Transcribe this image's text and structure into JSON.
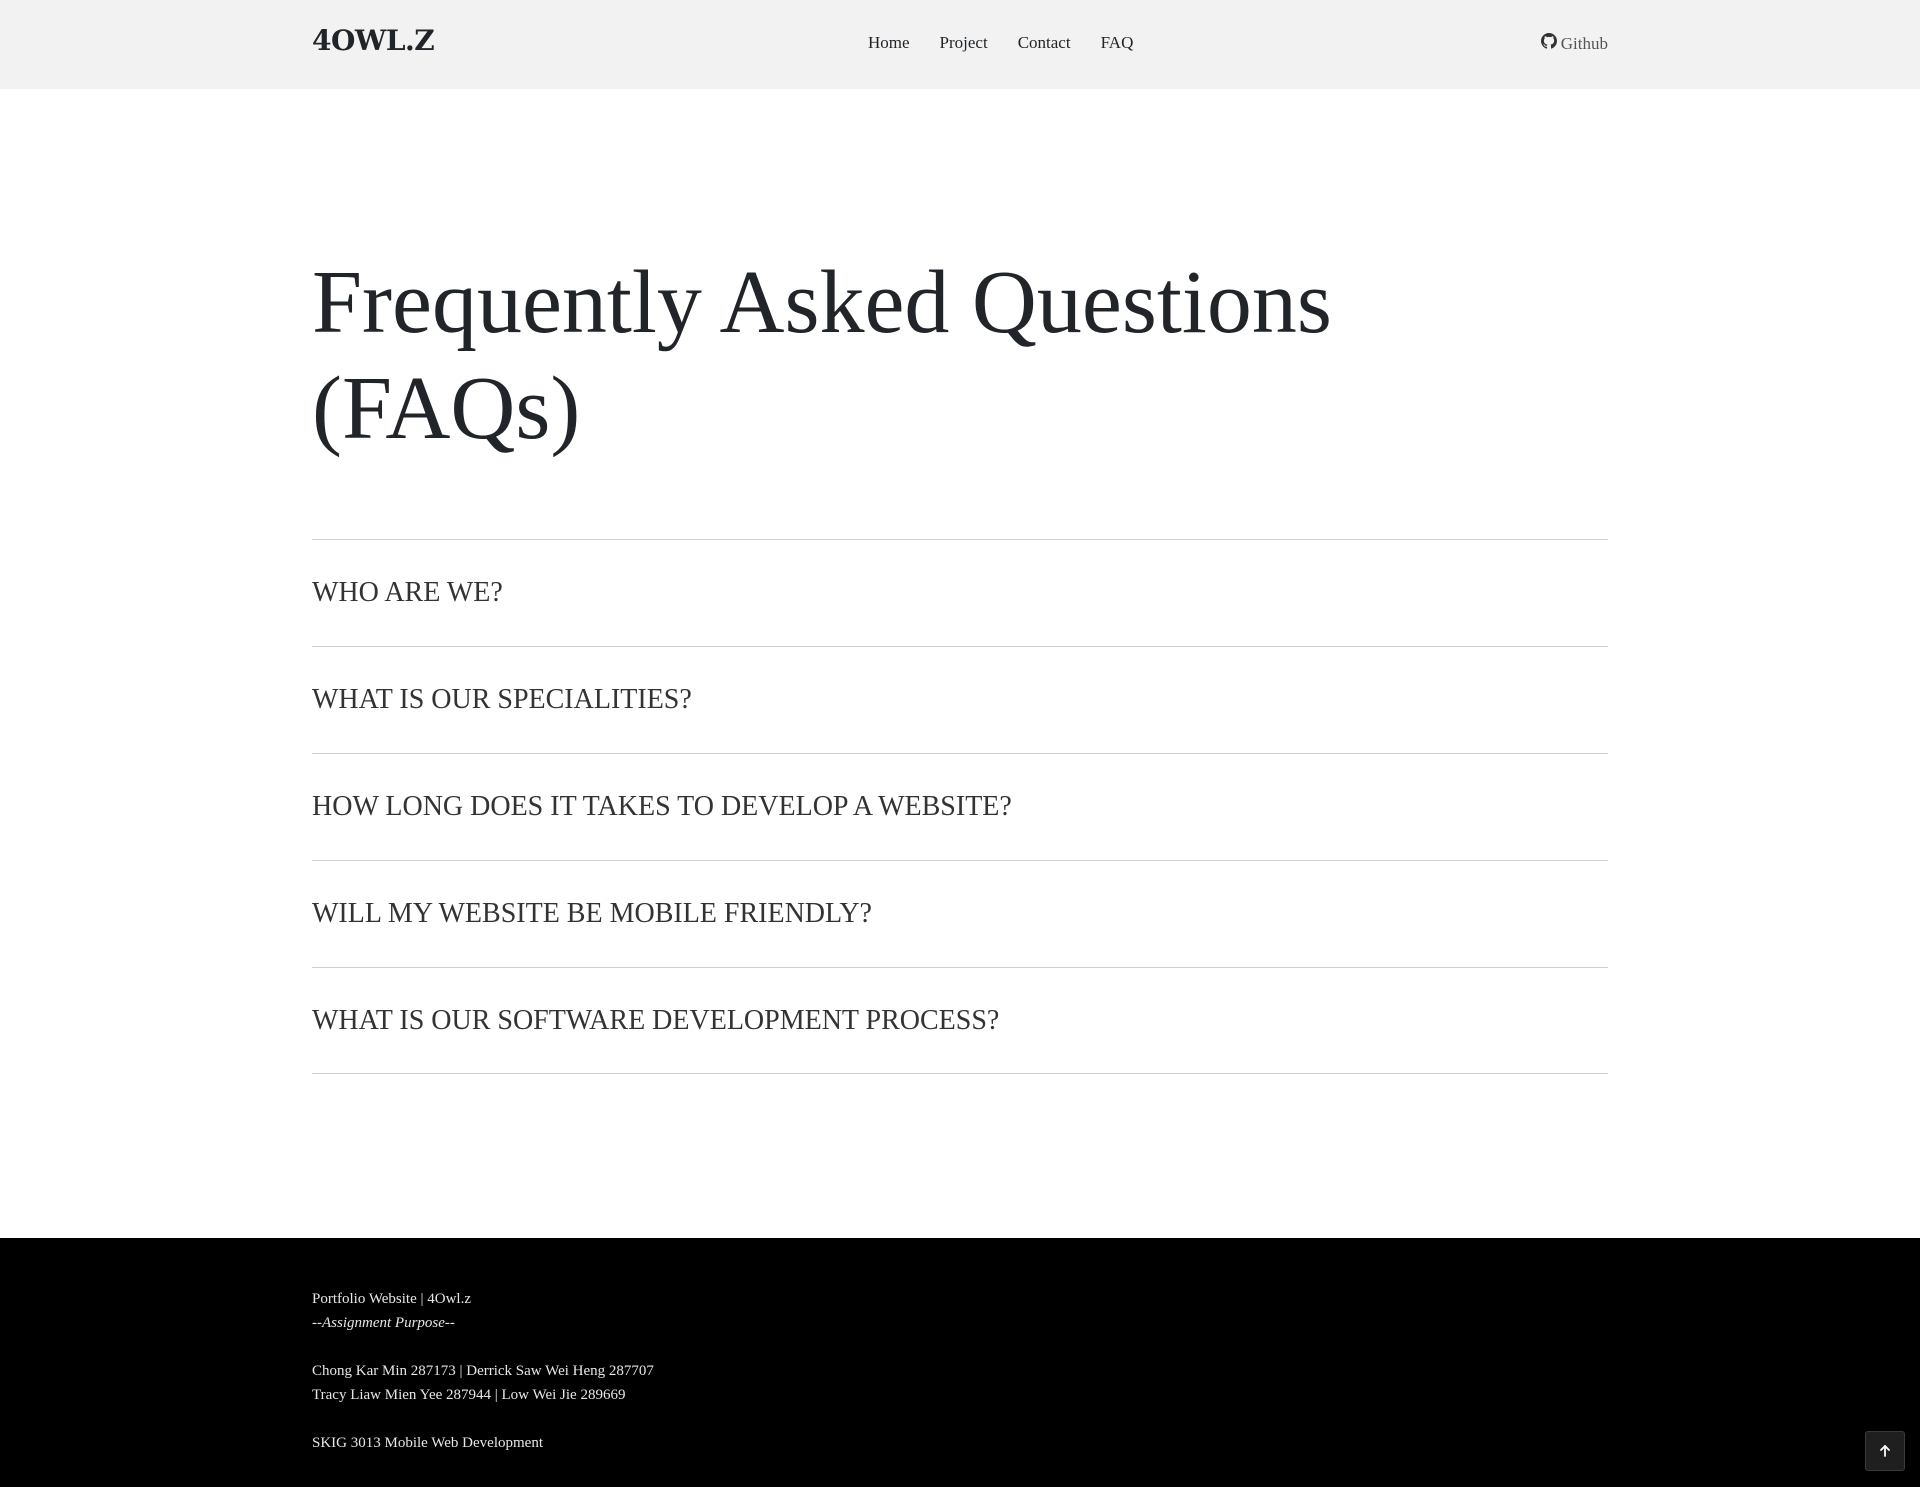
{
  "navbar": {
    "brand": "4OWL.Z",
    "links": [
      "Home",
      "Project",
      "Contact",
      "FAQ"
    ],
    "github_label": "Github"
  },
  "hero": {
    "title_line1": "Frequently Asked Questions",
    "title_line2": "(FAQs)"
  },
  "faq": {
    "items": [
      "WHO ARE WE?",
      "WHAT IS OUR SPECIALITIES?",
      "HOW LONG DOES IT TAKES TO DEVELOP A WEBSITE?",
      "WILL MY WEBSITE BE MOBILE FRIENDLY?",
      "WHAT IS OUR SOFTWARE DEVELOPMENT PROCESS?"
    ]
  },
  "footer": {
    "line1": "Portfolio Website | 4Owl.z",
    "line2": "--Assignment Purpose--",
    "line3": "Chong Kar Min 287173 | Derrick Saw Wei Heng 287707",
    "line4": "Tracy Liaw Mien Yee 287944 | Low Wei Jie 289669",
    "line5": "SKIG 3013 Mobile Web Development"
  },
  "icons": {
    "github": "github-icon",
    "back_to_top": "arrow-up-icon"
  },
  "colors": {
    "navbar_bg": "#f2f2f2",
    "footer_bg": "#000000",
    "text": "#212529"
  }
}
